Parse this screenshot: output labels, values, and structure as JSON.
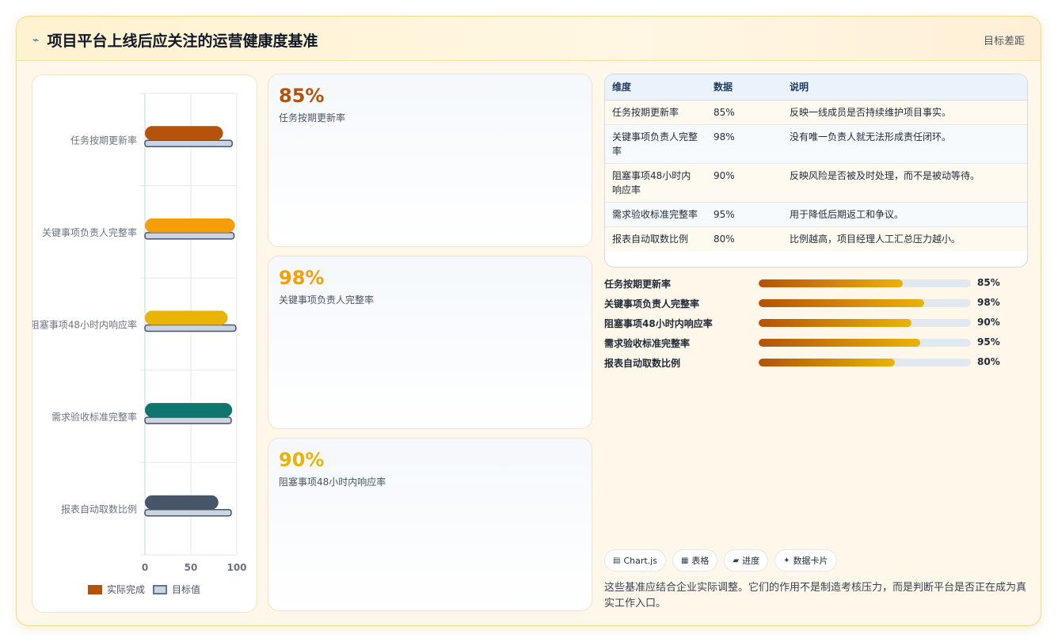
{
  "header": {
    "icon": "trend-icon",
    "title": "项目平台上线后应关注的运营健康度基准",
    "right_label": "目标差距"
  },
  "chart_data": {
    "type": "bar",
    "orientation": "horizontal",
    "categories": [
      "任务按期更新率",
      "关键事项负责人完整率",
      "阻塞事项48小时内响应率",
      "需求验收标准完整率",
      "报表自动取数比例"
    ],
    "series": [
      {
        "name": "实际完成",
        "values": [
          85,
          98,
          90,
          95,
          80
        ],
        "colors": [
          "#b45309",
          "#f59e0b",
          "#eab308",
          "#0f766e",
          "#475569"
        ]
      },
      {
        "name": "目标值",
        "values": [
          95,
          97,
          99,
          94,
          94
        ],
        "color": "#cbd5e1"
      }
    ],
    "x_ticks": [
      "0",
      "50",
      "100"
    ],
    "xlim": [
      0,
      100
    ],
    "grid": true,
    "legend_position": "bottom"
  },
  "stats": [
    {
      "value": "85%",
      "label": "任务按期更新率",
      "color": "#b45309"
    },
    {
      "value": "98%",
      "label": "关键事项负责人完整率",
      "color": "#f59e0b"
    },
    {
      "value": "90%",
      "label": "阻塞事项48小时内响应率",
      "color": "#eab308"
    }
  ],
  "table": {
    "headers": [
      "维度",
      "数据",
      "说明"
    ],
    "rows": [
      [
        "任务按期更新率",
        "85%",
        "反映一线成员是否持续维护项目事实。"
      ],
      [
        "关键事项负责人完整率",
        "98%",
        "没有唯一负责人就无法形成责任闭环。"
      ],
      [
        "阻塞事项48小时内响应率",
        "90%",
        "反映风险是否被及时处理，而不是被动等待。"
      ],
      [
        "需求验收标准完整率",
        "95%",
        "用于降低后期返工和争议。"
      ],
      [
        "报表自动取数比例",
        "80%",
        "比例越高，项目经理人工汇总压力越小。"
      ]
    ]
  },
  "progress": [
    {
      "label": "任务按期更新率",
      "pct": "85%",
      "value": 85
    },
    {
      "label": "关键事项负责人完整率",
      "pct": "98%",
      "value": 98
    },
    {
      "label": "阻塞事项48小时内响应率",
      "pct": "90%",
      "value": 90
    },
    {
      "label": "需求验收标准完整率",
      "pct": "95%",
      "value": 95
    },
    {
      "label": "报表自动取数比例",
      "pct": "80%",
      "value": 80
    }
  ],
  "tags": [
    {
      "icon": "chart-icon",
      "glyph": "▤",
      "label": "Chart.js"
    },
    {
      "icon": "table-icon",
      "glyph": "▦",
      "label": "表格"
    },
    {
      "icon": "progress-icon",
      "glyph": "▰",
      "label": "进度"
    },
    {
      "icon": "card-icon",
      "glyph": "✦",
      "label": "数据卡片"
    }
  ],
  "footer_note": "这些基准应结合企业实际调整。它们的作用不是制造考核压力，而是判断平台是否正在成为真实工作入口。"
}
